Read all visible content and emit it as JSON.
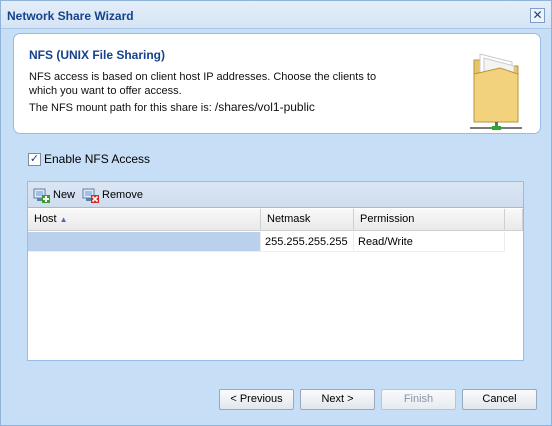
{
  "window": {
    "title": "Network Share Wizard",
    "close_glyph": "✕"
  },
  "header": {
    "title": "NFS (UNIX File Sharing)",
    "description": "NFS access is based on client host IP addresses. Choose the clients to which you want to offer access.",
    "path_label": "The NFS mount path for this share is:",
    "path_value": "/shares/vol1-public",
    "icon": "folder-share-icon"
  },
  "nfs": {
    "checkbox_label": "Enable NFS Access",
    "checked": true,
    "check_glyph": "✓"
  },
  "toolbar": {
    "new_label": "New",
    "remove_label": "Remove"
  },
  "table": {
    "columns": [
      "Host",
      "Netmask",
      "Permission"
    ],
    "sort_glyph": "▲",
    "rows": [
      {
        "host": "",
        "netmask": "255.255.255.255",
        "permission": "Read/Write"
      }
    ]
  },
  "buttons": {
    "previous": "< Previous",
    "next": "Next >",
    "finish": "Finish",
    "cancel": "Cancel"
  },
  "colors": {
    "accent": "#15428b",
    "window_bg": "#c7dff6",
    "panel_border": "#99bbe8",
    "selected_row": "#b9d1ec"
  }
}
